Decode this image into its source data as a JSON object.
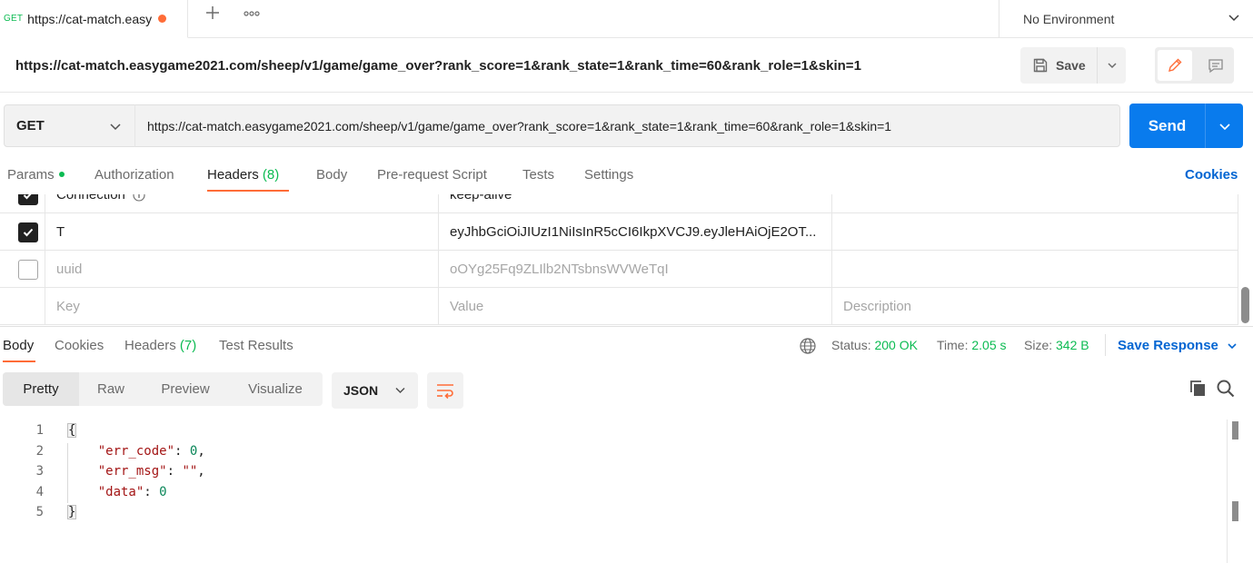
{
  "tab_bar": {
    "request_tab": {
      "method": "GET",
      "title": "https://cat-match.easy"
    },
    "new_tab_icon": "plus-icon",
    "more_icon": "more-horizontal-icon",
    "environment": "No Environment"
  },
  "request": {
    "name": "https://cat-match.easygame2021.com/sheep/v1/game/game_over?rank_score=1&rank_state=1&rank_time=60&rank_role=1&skin=1",
    "save_label": "Save",
    "method": "GET",
    "url": "https://cat-match.easygame2021.com/sheep/v1/game/game_over?rank_score=1&rank_state=1&rank_time=60&rank_role=1&skin=1",
    "send_label": "Send"
  },
  "request_tabs": {
    "params": "Params",
    "authorization": "Authorization",
    "headers": "Headers",
    "headers_count": "(8)",
    "body": "Body",
    "pre_request": "Pre-request Script",
    "tests": "Tests",
    "settings": "Settings",
    "cookies": "Cookies",
    "active": "Headers"
  },
  "headers_table": {
    "rows": [
      {
        "checked": true,
        "key": "Connection",
        "value": "keep-alive",
        "description": ""
      },
      {
        "checked": true,
        "key": "T",
        "value": "eyJhbGciOiJIUzI1NiIsInR5cCI6IkpXVCJ9.eyJleHAiOjE2OT...",
        "description": ""
      },
      {
        "checked": false,
        "key": "uuid",
        "value": "oOYg25Fq9ZLIlb2NTsbnsWVWeTqI",
        "description": ""
      }
    ],
    "placeholder": {
      "key": "Key",
      "value": "Value",
      "description": "Description"
    }
  },
  "response": {
    "tabs": {
      "body": "Body",
      "cookies": "Cookies",
      "headers": "Headers",
      "headers_count": "(7)",
      "test_results": "Test Results"
    },
    "status_label": "Status:",
    "status": "200 OK",
    "time_label": "Time:",
    "time": "2.05 s",
    "size_label": "Size:",
    "size": "342 B",
    "save_response": "Save Response",
    "views": [
      "Pretty",
      "Raw",
      "Preview",
      "Visualize"
    ],
    "active_view": "Pretty",
    "format": "JSON",
    "code": {
      "line_numbers": [
        "1",
        "2",
        "3",
        "4",
        "5"
      ],
      "open": "{",
      "close": "}",
      "entries": [
        {
          "key": "\"err_code\"",
          "value": "0",
          "sep": ": ",
          "tail": ","
        },
        {
          "key": "\"err_msg\"",
          "value": "\"\"",
          "sep": ": ",
          "tail": ","
        },
        {
          "key": "\"data\"",
          "value": "0",
          "sep": ": ",
          "tail": ""
        }
      ]
    }
  },
  "colors": {
    "accent": "#ff6c37",
    "primary": "#097bed",
    "success": "#0cbb52",
    "link": "#0265d2"
  }
}
